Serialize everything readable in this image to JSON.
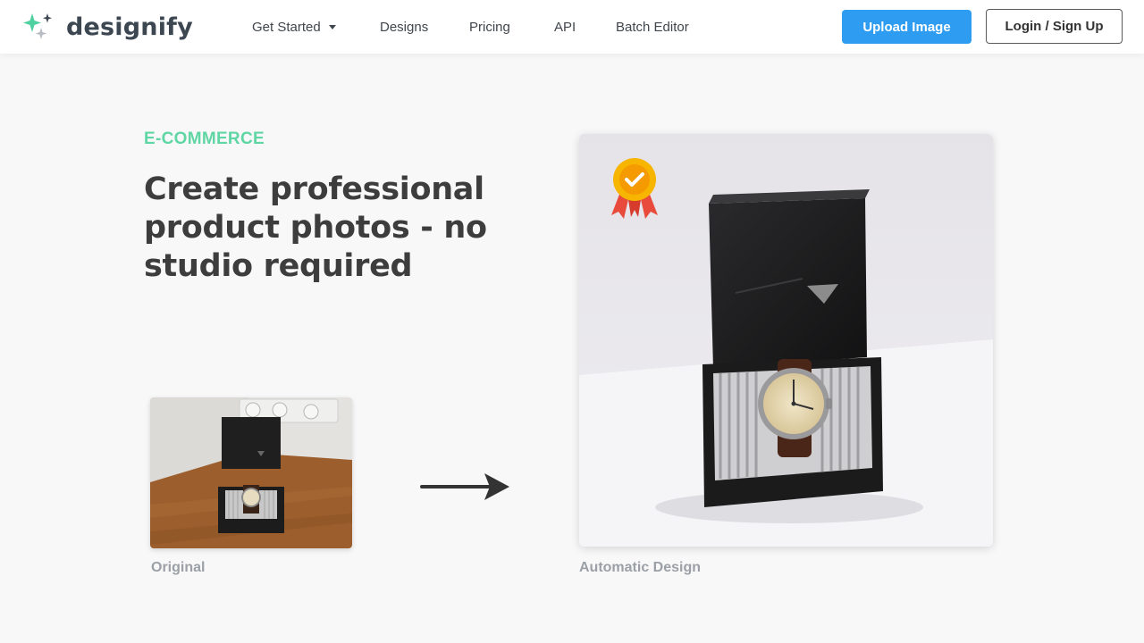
{
  "brand": {
    "name": "designify",
    "logo_icon": "sparkle-icon",
    "accent": "#2e9cf0",
    "green": "#5fd6a4"
  },
  "nav": {
    "items": [
      {
        "label": "Get Started",
        "has_dropdown": true
      },
      {
        "label": "Designs"
      },
      {
        "label": "Pricing"
      },
      {
        "label": "API"
      },
      {
        "label": "Batch Editor"
      }
    ],
    "upload_label": "Upload Image",
    "login_label": "Login / Sign Up"
  },
  "hero": {
    "eyebrow": "E-COMMERCE",
    "headline": "Create professional product photos - no studio required",
    "original_caption": "Original",
    "result_caption": "Automatic Design",
    "arrow_icon": "arrow-right-icon",
    "badge_icon": "award-ribbon-icon"
  }
}
